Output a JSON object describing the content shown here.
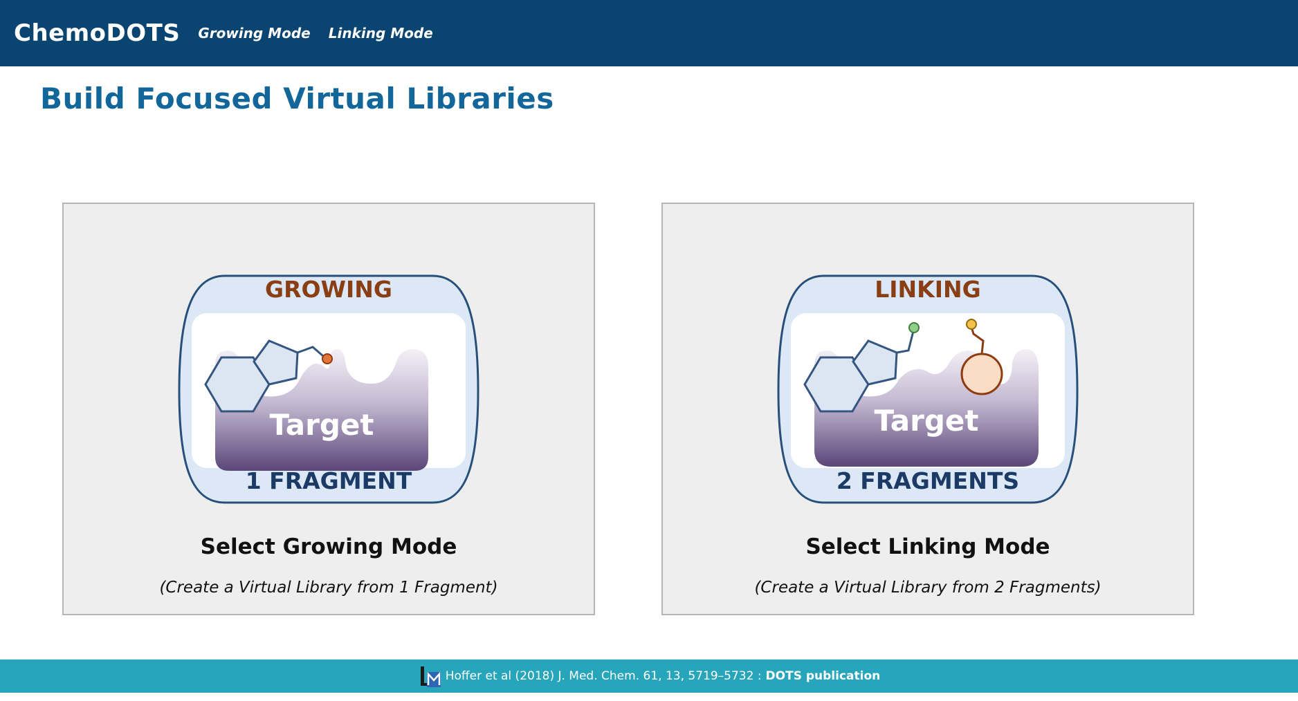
{
  "nav": {
    "brand": "ChemoDOTS",
    "links": [
      "Growing Mode",
      "Linking Mode"
    ]
  },
  "page": {
    "title": "Build Focused Virtual Libraries"
  },
  "cards": [
    {
      "badge_top": "GROWING",
      "badge_target": "Target",
      "badge_bottom": "1 FRAGMENT",
      "title": "Select Growing Mode",
      "subtitle": "(Create a Virtual Library from 1 Fragment)"
    },
    {
      "badge_top": "LINKING",
      "badge_target": "Target",
      "badge_bottom": "2 FRAGMENTS",
      "title": "Select Linking Mode",
      "subtitle": "(Create a Virtual Library from 2 Fragments)"
    }
  ],
  "footer": {
    "citation": "Hoffer et al (2018) J. Med. Chem. 61, 13, 5719–5732 :",
    "link": "DOTS publication"
  },
  "colors": {
    "nav_bg": "#0a4470",
    "title": "#12669a",
    "footer_bg": "#26a5bb",
    "card_bg": "#eeeeee",
    "badge_brown": "#8a3e14",
    "badge_navy": "#1c3a66"
  },
  "icons": [
    "lm-logo-icon",
    "fragment-molecule-icon",
    "target-pocket-icon"
  ]
}
